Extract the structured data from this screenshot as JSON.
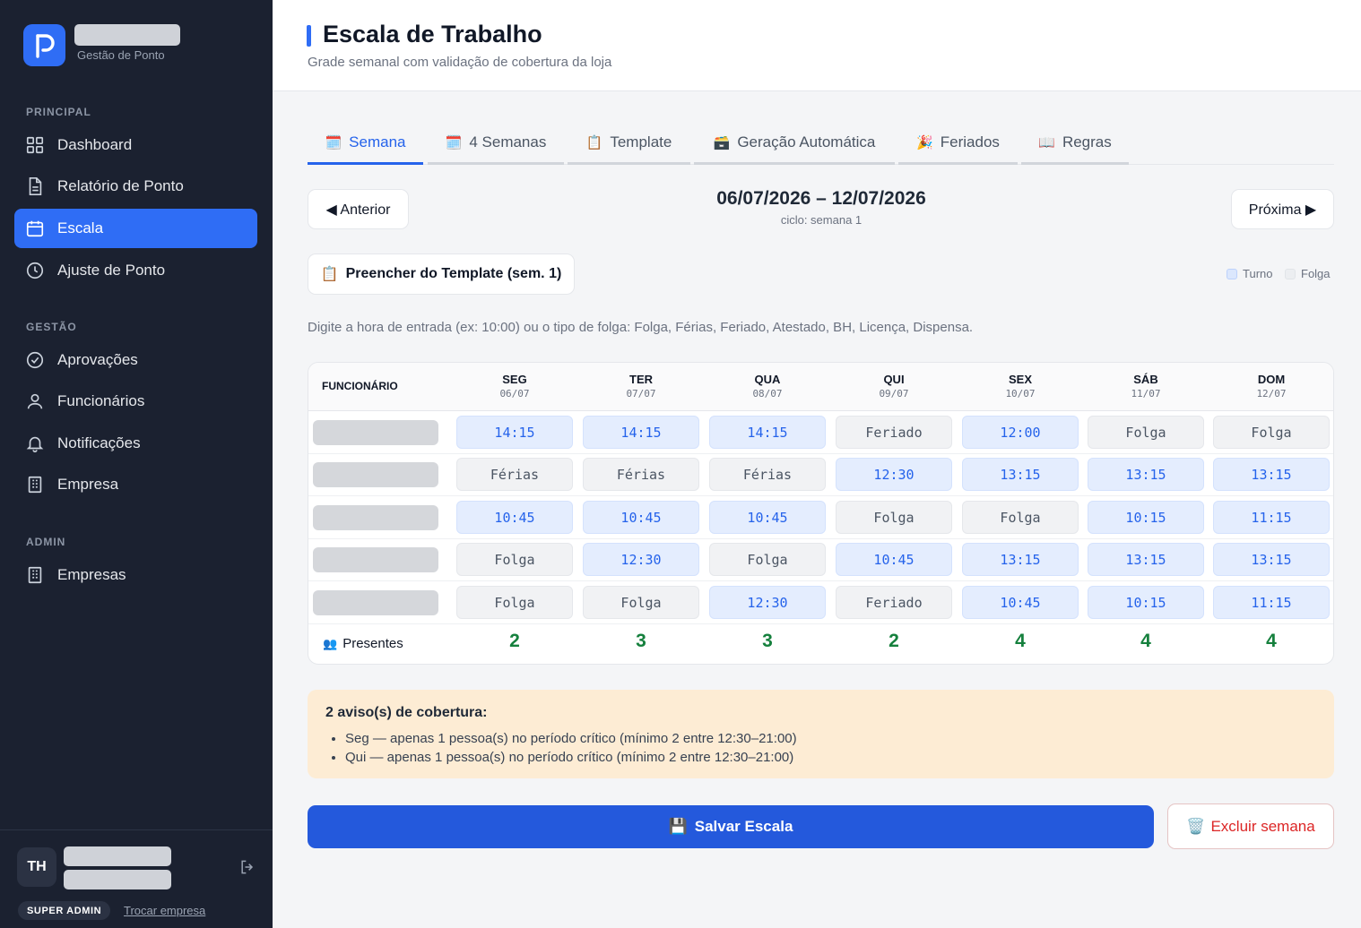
{
  "brand": {
    "subtitle": "Gestão de Ponto"
  },
  "sidebar": {
    "sections": [
      "PRINCIPAL",
      "GESTÃO",
      "ADMIN"
    ],
    "items": [
      {
        "label": "Dashboard",
        "icon": "grid-icon"
      },
      {
        "label": "Relatório de Ponto",
        "icon": "document-icon"
      },
      {
        "label": "Escala",
        "icon": "calendar-icon",
        "active": true
      },
      {
        "label": "Ajuste de Ponto",
        "icon": "clock-icon"
      },
      {
        "label": "Aprovações",
        "icon": "check-circle-icon"
      },
      {
        "label": "Funcionários",
        "icon": "user-icon"
      },
      {
        "label": "Notificações",
        "icon": "bell-icon"
      },
      {
        "label": "Empresa",
        "icon": "building-icon"
      },
      {
        "label": "Empresas",
        "icon": "building-icon"
      }
    ]
  },
  "user": {
    "initials": "TH",
    "role": "SUPER ADMIN",
    "switch_label": "Trocar empresa"
  },
  "header": {
    "title": "Escala de Trabalho",
    "subtitle": "Grade semanal com validação de cobertura da loja"
  },
  "tabs": [
    {
      "label": "Semana",
      "icon": "🗓️",
      "active": true
    },
    {
      "label": "4 Semanas",
      "icon": "🗓️"
    },
    {
      "label": "Template",
      "icon": "📋"
    },
    {
      "label": "Geração Automática",
      "icon": "🗃️"
    },
    {
      "label": "Feriados",
      "icon": "🎉"
    },
    {
      "label": "Regras",
      "icon": "📖"
    }
  ],
  "week": {
    "prev_label": "◀ Anterior",
    "next_label": "Próxima ▶",
    "range": "06/07/2026 – 12/07/2026",
    "cycle": "ciclo: semana 1"
  },
  "fill_template_label": "Preencher do Template (sem. 1)",
  "fill_template_icon": "📋",
  "legend": [
    {
      "label": "Turno",
      "color": "#dbe7fd"
    },
    {
      "label": "Folga",
      "color": "#eceef1"
    }
  ],
  "hint": "Digite a hora de entrada (ex: 10:00) ou o tipo de folga: Folga, Férias, Feriado, Atestado, BH, Licença, Dispensa.",
  "grid": {
    "employee_header": "FUNCIONÁRIO",
    "days": [
      {
        "day": "SEG",
        "date": "06/07"
      },
      {
        "day": "TER",
        "date": "07/07"
      },
      {
        "day": "QUA",
        "date": "08/07"
      },
      {
        "day": "QUI",
        "date": "09/07"
      },
      {
        "day": "SEX",
        "date": "10/07"
      },
      {
        "day": "SÁB",
        "date": "11/07"
      },
      {
        "day": "DOM",
        "date": "12/07"
      }
    ],
    "rows": [
      [
        "14:15",
        "14:15",
        "14:15",
        "Feriado",
        "12:00",
        "Folga",
        "Folga"
      ],
      [
        "Férias",
        "Férias",
        "Férias",
        "12:30",
        "13:15",
        "13:15",
        "13:15"
      ],
      [
        "10:45",
        "10:45",
        "10:45",
        "Folga",
        "Folga",
        "10:15",
        "11:15"
      ],
      [
        "Folga",
        "12:30",
        "Folga",
        "10:45",
        "13:15",
        "13:15",
        "13:15"
      ],
      [
        "Folga",
        "Folga",
        "12:30",
        "Feriado",
        "10:45",
        "10:15",
        "11:15"
      ]
    ],
    "present_label": "Presentes",
    "present_icon": "👥",
    "present_counts": [
      2,
      3,
      3,
      2,
      4,
      4,
      4
    ]
  },
  "warnings": {
    "title": "2 aviso(s) de cobertura:",
    "items": [
      "Seg — apenas 1 pessoa(s) no período crítico (mínimo 2 entre 12:30–21:00)",
      "Qui — apenas 1 pessoa(s) no período crítico (mínimo 2 entre 12:30–21:00)"
    ]
  },
  "actions": {
    "save_label": "Salvar Escala",
    "save_icon": "💾",
    "delete_label": "Excluir semana",
    "delete_icon": "🗑️"
  }
}
